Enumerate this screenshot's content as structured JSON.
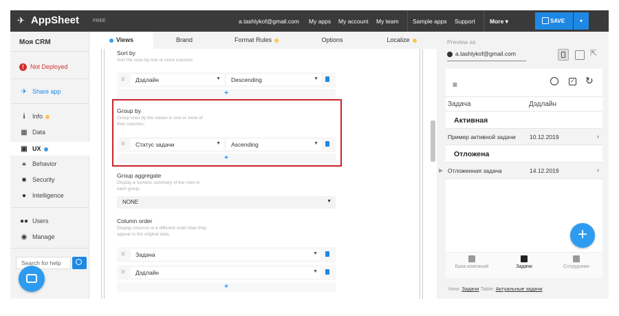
{
  "topbar": {
    "logo": "AppSheet",
    "plan": "FREE",
    "user_email": "a.tashlykof@gmail.com",
    "nav": [
      "My apps",
      "My account",
      "My team",
      "Sample apps",
      "Support",
      "More ▾"
    ],
    "save_label": "SAVE",
    "save_dropdown": "▾"
  },
  "sidebar": {
    "app_name": "Моя CRM",
    "status": "Not Deployed",
    "share": "Share app",
    "items": [
      {
        "label": "Info",
        "icon": "info-icon"
      },
      {
        "label": "Data",
        "icon": "table-icon"
      },
      {
        "label": "UX",
        "icon": "ux-icon"
      },
      {
        "label": "Behavior",
        "icon": "sitemap-icon"
      },
      {
        "label": "Security",
        "icon": "lock-icon"
      },
      {
        "label": "Intelligence",
        "icon": "lightbulb-icon"
      },
      {
        "label": "Users",
        "icon": "users-icon"
      },
      {
        "label": "Manage",
        "icon": "manage-icon"
      }
    ],
    "search_placeholder": "Search for help"
  },
  "tabs": [
    "Views",
    "Brand",
    "Format Rules",
    "Options",
    "Localize"
  ],
  "editor": {
    "sort_by": {
      "title": "Sort by",
      "desc": "Sort the rows by one or more columns.",
      "column": "Дэдлайн",
      "order": "Descending"
    },
    "group_by": {
      "title": "Group by",
      "desc": "Group rows by the values in one or more of their columns.",
      "column": "Статус задачи",
      "order": "Ascending"
    },
    "group_aggregate": {
      "title": "Group aggregate",
      "desc": "Display a numeric summary of the rows in each group.",
      "value": "NONE"
    },
    "column_order": {
      "title": "Column order",
      "desc": "Display columns in a different order than they appear in the original data.",
      "columns": [
        "Задача",
        "Дэдлайн"
      ]
    },
    "add": "+"
  },
  "preview": {
    "label": "Preview as",
    "user": "a.tashlykof@gmail.com",
    "table_headers": [
      "Задача",
      "Дэдлайн"
    ],
    "groups": [
      {
        "name": "Активная",
        "row": {
          "task": "Пример активной задачи",
          "date": "10.12.2019"
        }
      },
      {
        "name": "Отложена",
        "row": {
          "task": "Отложенная задача",
          "date": "14.12.2019"
        }
      }
    ],
    "bottom_nav": [
      "База компаний",
      "Задачи",
      "Сотрудники"
    ],
    "view_label": "View:",
    "view_value": "Задачи",
    "table_label": "Table:",
    "table_value": "Актуальные задачи"
  },
  "colors": {
    "accent": "#1e88e5",
    "highlight_border": "#c6252a",
    "warning_dot": "#f9c846",
    "error": "#d32f2f"
  }
}
